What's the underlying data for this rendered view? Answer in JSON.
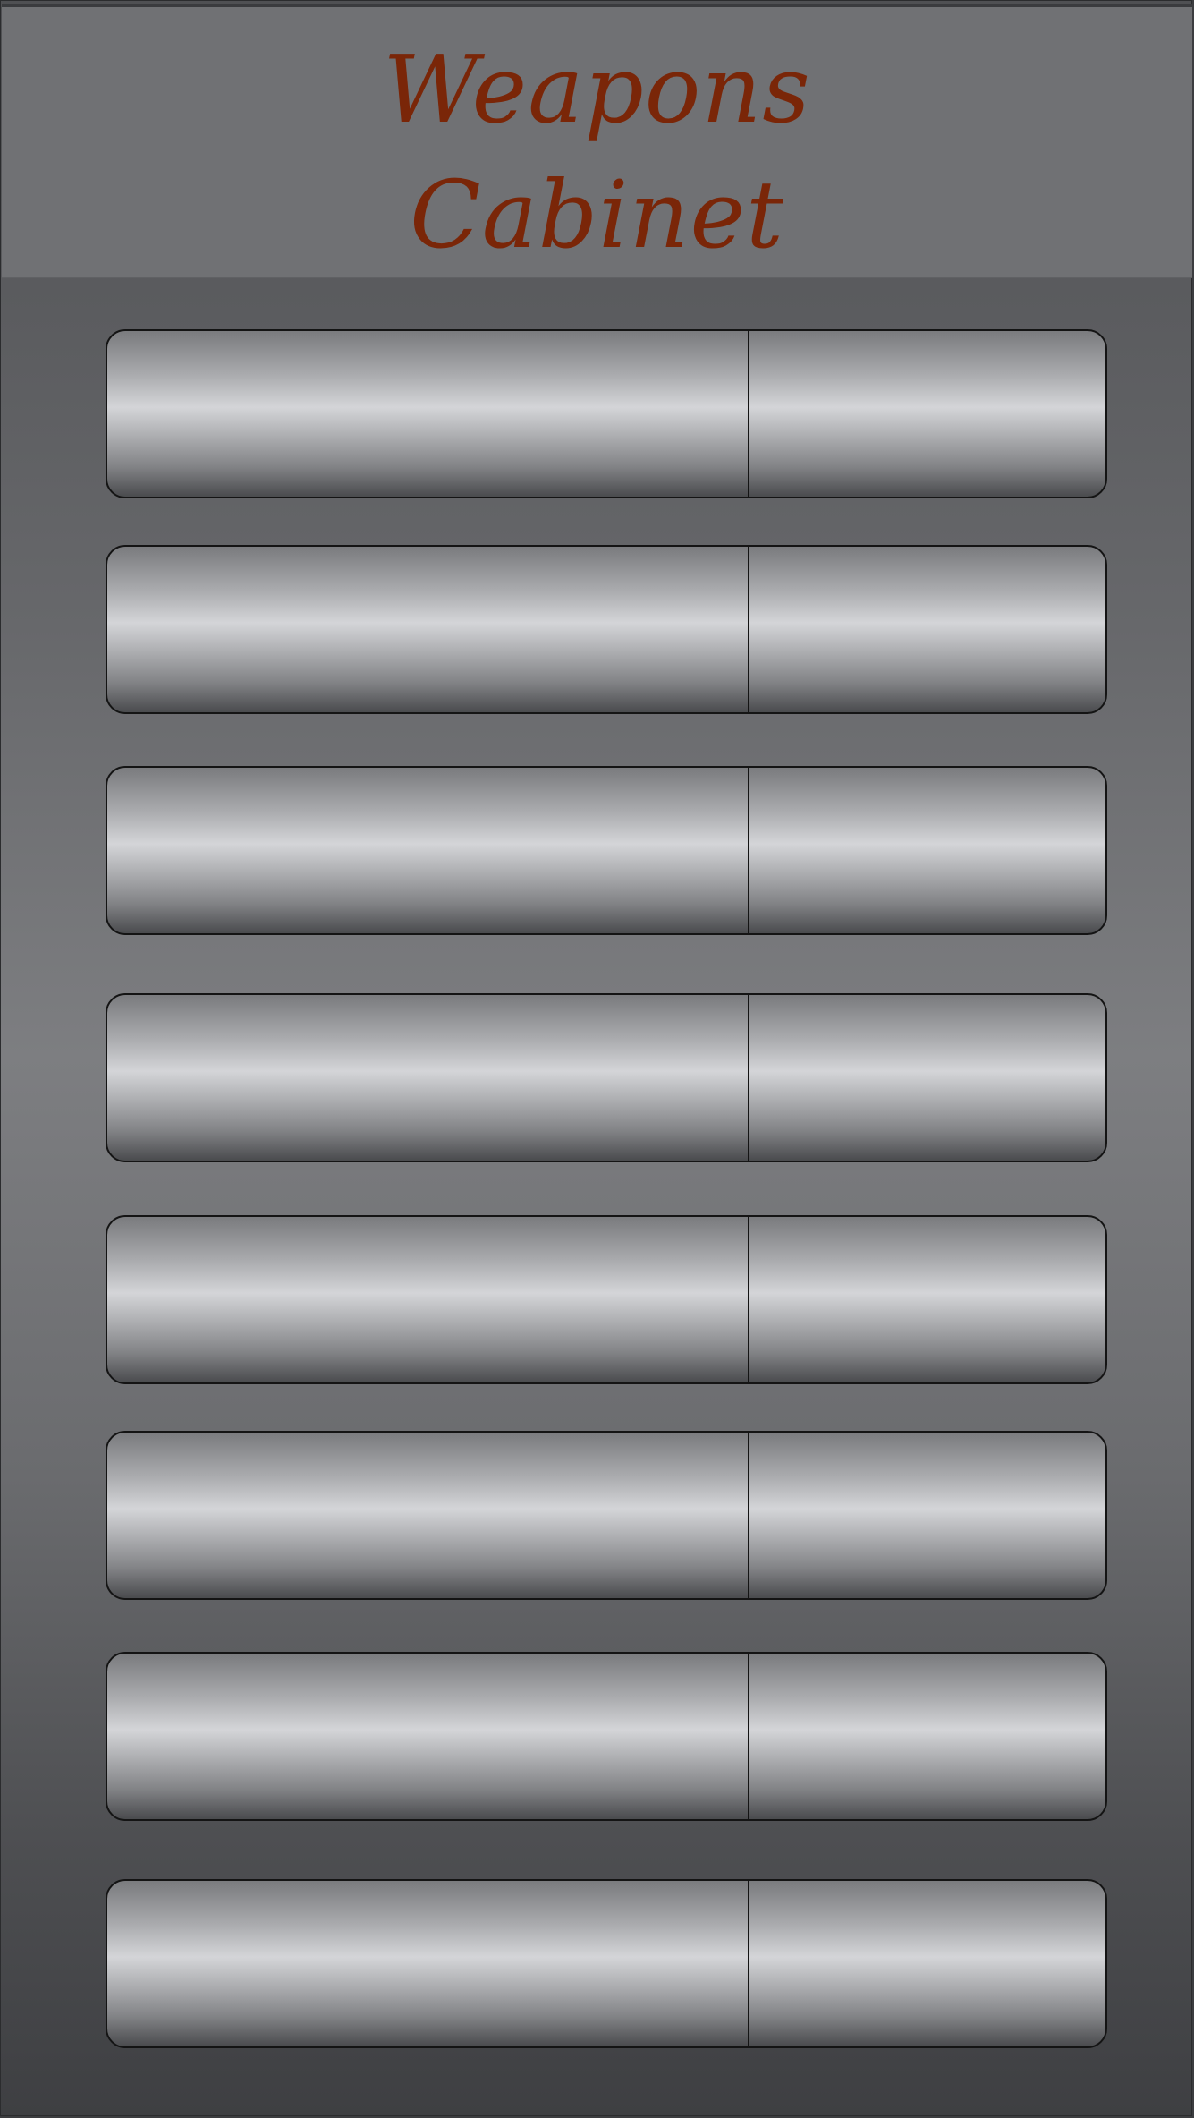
{
  "header": {
    "title_line1": "Weapons",
    "title_line2": "Cabinet"
  },
  "colors": {
    "title": "#7a2608",
    "header_background": "#707174",
    "slot_border": "#141414"
  },
  "slots": [
    {
      "name": "",
      "value": ""
    },
    {
      "name": "",
      "value": ""
    },
    {
      "name": "",
      "value": ""
    },
    {
      "name": "",
      "value": ""
    },
    {
      "name": "",
      "value": ""
    },
    {
      "name": "",
      "value": ""
    },
    {
      "name": "",
      "value": ""
    },
    {
      "name": "",
      "value": ""
    }
  ]
}
